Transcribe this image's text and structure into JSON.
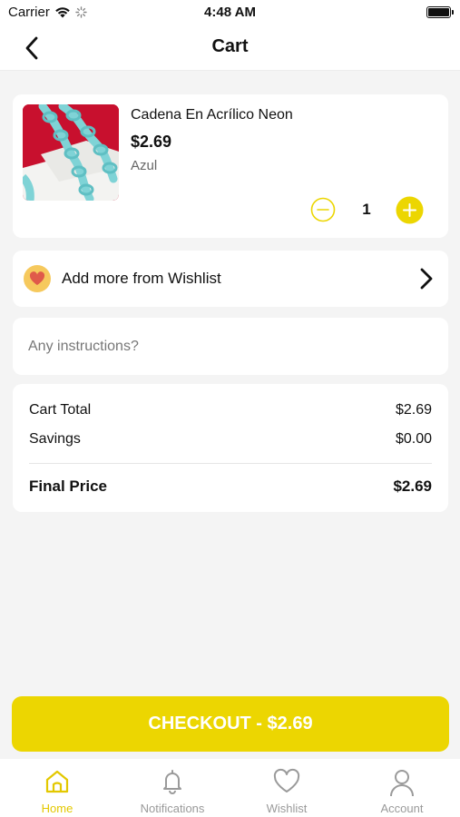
{
  "status_bar": {
    "carrier": "Carrier",
    "time": "4:48 AM"
  },
  "nav": {
    "title": "Cart",
    "back_icon": "chevron-left-icon"
  },
  "cart": {
    "item": {
      "name": "Cadena En Acrílico Neon",
      "price": "$2.69",
      "variant": "Azul",
      "quantity": "1"
    }
  },
  "wishlist": {
    "label": "Add more from Wishlist"
  },
  "instructions": {
    "placeholder": "Any instructions?"
  },
  "summary": {
    "cart_total_label": "Cart Total",
    "cart_total_value": "$2.69",
    "savings_label": "Savings",
    "savings_value": "$0.00",
    "final_price_label": "Final Price",
    "final_price_value": "$2.69"
  },
  "checkout": {
    "label": "CHECKOUT - $2.69"
  },
  "tabs": [
    {
      "label": "Home",
      "icon": "home-icon",
      "active": true
    },
    {
      "label": "Notifications",
      "icon": "bell-icon",
      "active": false
    },
    {
      "label": "Wishlist",
      "icon": "heart-icon",
      "active": false
    },
    {
      "label": "Account",
      "icon": "user-icon",
      "active": false
    }
  ],
  "colors": {
    "accent": "#ecd601",
    "accent_text": "#e3c800",
    "background": "#f4f4f4"
  }
}
